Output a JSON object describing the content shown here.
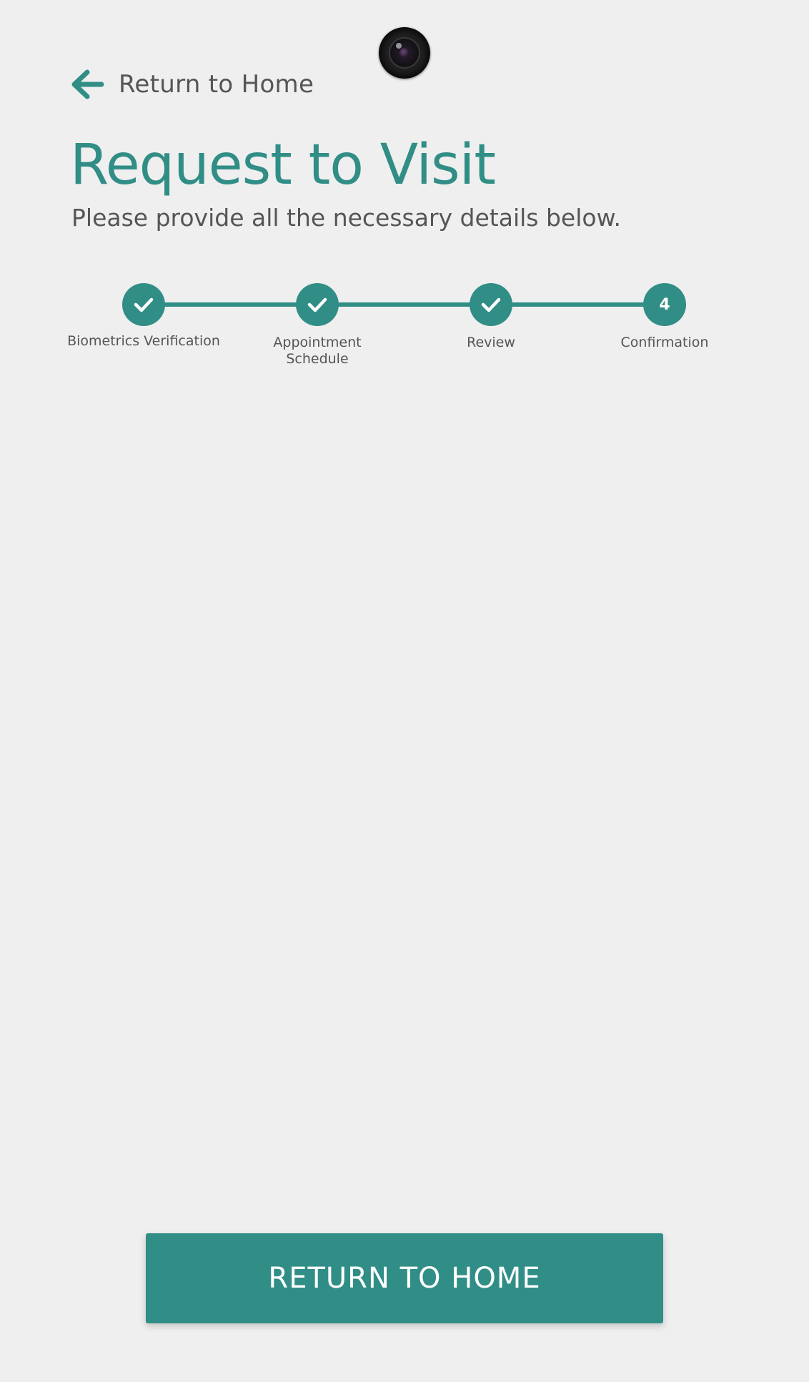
{
  "header": {
    "back_label": "Return to Home",
    "title": "Request to Visit",
    "subtitle": "Please provide all the necessary details below."
  },
  "stepper": {
    "steps": [
      {
        "label_line1": "Biometrics Verification",
        "label_line2": "",
        "state": "complete",
        "icon": "check-icon"
      },
      {
        "label_line1": "Appointment",
        "label_line2": "Schedule",
        "state": "complete",
        "icon": "check-icon"
      },
      {
        "label_line1": "Review",
        "label_line2": "",
        "state": "complete",
        "icon": "check-icon"
      },
      {
        "label_line1": "Confirmation",
        "label_line2": "",
        "state": "current",
        "number": "4"
      }
    ]
  },
  "footer": {
    "button_label": "RETURN TO HOME"
  },
  "colors": {
    "accent": "#318e86",
    "background": "#efefef",
    "text": "#555555"
  }
}
